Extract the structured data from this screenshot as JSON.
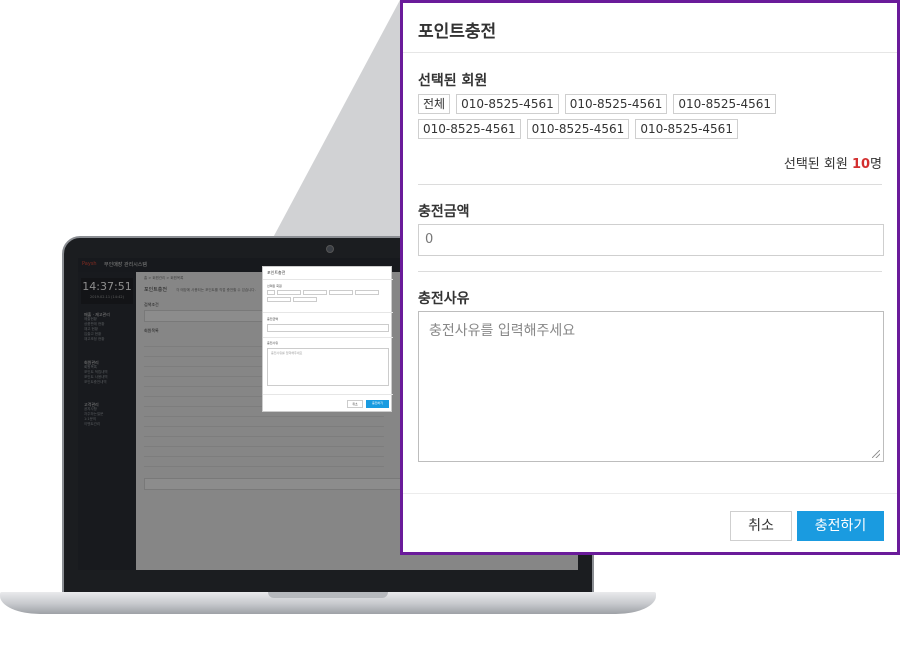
{
  "laptop_screen": {
    "app_logo": "Paysh",
    "app_title": "무인매장 관리시스템",
    "clock_time": "14:37:51",
    "clock_date": "2019.02.11 (14:42)",
    "menu_groups": [
      {
        "heading": "매출 · 재고관리",
        "items": [
          "매출현황",
          "상품판매 현황",
          "재고 현황",
          "입출고 현황",
          "재고조정 현황"
        ]
      },
      {
        "heading": "회원관리",
        "items": [
          "회원목록",
          "포인트 적립내역",
          "포인트 사용내역",
          "포인트충전내역"
        ]
      },
      {
        "heading": "고객관리",
        "items": [
          "공지사항",
          "자주하는질문",
          "1:1문의",
          "이벤트관리"
        ]
      }
    ],
    "breadcrumb": "홈 > 회원관리 > 회원목록",
    "page_title": "포인트충전",
    "page_desc": "각 매장에 사용되는 포인트를 직접 충전할 수 있습니다.",
    "search_label": "검색조건",
    "list_label": "회원목록",
    "modal": {
      "title": "포인트충전",
      "selected_label": "선택된 회원",
      "amount_label": "충전금액",
      "reason_label": "충전사유",
      "reason_placeholder": "충전사유를 입력해주세요",
      "cancel": "취소",
      "submit": "충전하기"
    }
  },
  "modal": {
    "title": "포인트충전",
    "selected_members_label": "선택된 회원",
    "member_tags": [
      "전체",
      "010-8525-4561",
      "010-8525-4561",
      "010-8525-4561",
      "010-8525-4561",
      "010-8525-4561",
      "010-8525-4561"
    ],
    "selected_count_prefix": "선택된 회원 ",
    "selected_count": "10",
    "selected_count_suffix": "명",
    "amount_label": "충전금액",
    "amount_value": "0",
    "reason_label": "충전사유",
    "reason_placeholder": "충전사유를 입력해주세요",
    "cancel_label": "취소",
    "submit_label": "충전하기"
  },
  "colors": {
    "modal_border": "#6a1b9a",
    "submit_button": "#1a9be0",
    "count_highlight": "#d32f2f"
  }
}
